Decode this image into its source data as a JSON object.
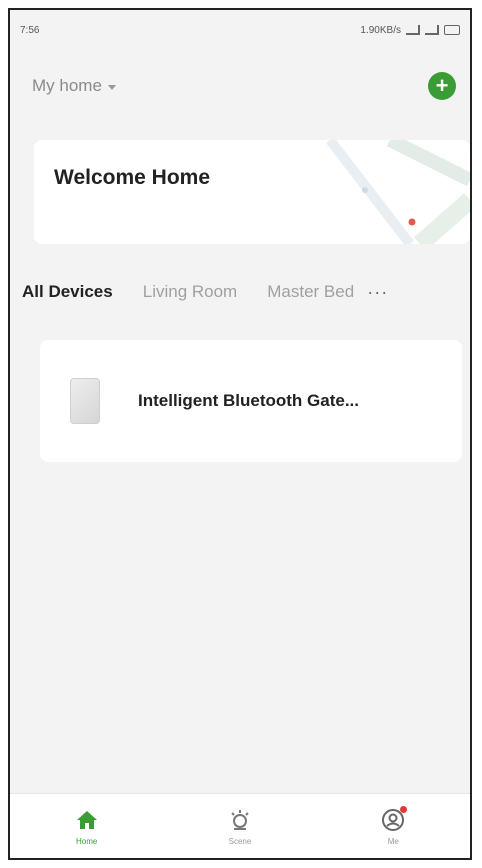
{
  "status_bar": {
    "time": "7:56",
    "right_text": "1.90KB/s"
  },
  "header": {
    "home_name": "My home",
    "add_label": "+"
  },
  "welcome": {
    "title": "Welcome Home"
  },
  "rooms": {
    "tabs": [
      {
        "label": "All Devices",
        "active": true
      },
      {
        "label": "Living Room",
        "active": false
      },
      {
        "label": "Master Bedroom",
        "active": false
      }
    ],
    "more_label": "···"
  },
  "devices": [
    {
      "name": "Intelligent Bluetooth Gate..."
    }
  ],
  "bottom_nav": {
    "items": [
      {
        "label": "Home",
        "icon": "home-icon",
        "active": true
      },
      {
        "label": "Scene",
        "icon": "scene-icon",
        "active": false
      },
      {
        "label": "Me",
        "icon": "profile-icon",
        "active": false
      }
    ]
  },
  "colors": {
    "accent": "#3a9c35",
    "badge": "#e53935",
    "background": "#f3f3f3"
  }
}
